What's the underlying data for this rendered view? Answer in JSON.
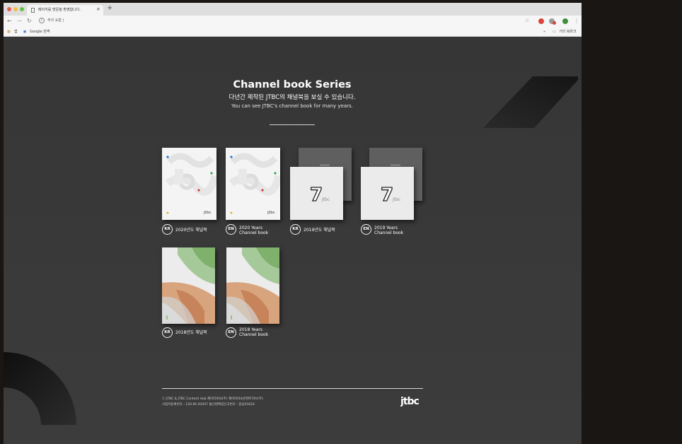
{
  "browser": {
    "tab_title": "페이지를 방문을 환영합니다.",
    "tab_close": "×",
    "new_tab": "+",
    "url_text": "주의 요함 |",
    "bookmarks": [
      "앱",
      "Google 번역"
    ],
    "bookmarks_other": "기타 북마크",
    "bookmarks_more": "»"
  },
  "page": {
    "title": "Channel book Series",
    "subtitle_ko": "다년간 제작된 JTBC의 채널북을 보실 수 있습니다.",
    "subtitle_en": "You can see JTBC's channel book for many years."
  },
  "books": [
    {
      "lang": "KR",
      "label": "2020년도 채널북",
      "style": "2020"
    },
    {
      "lang": "EN",
      "label": "2020 Years\nChannel book",
      "style": "2020"
    },
    {
      "lang": "KR",
      "label": "2019년도 채널북",
      "style": "2019"
    },
    {
      "lang": "EN",
      "label": "2019 Years\nChannel book",
      "style": "2019"
    },
    {
      "lang": "KR",
      "label": "2018년도 채널북",
      "style": "2018"
    },
    {
      "lang": "EN",
      "label": "2018 Years\nChannel book",
      "style": "2018"
    }
  ],
  "footer": {
    "copyright": "ⓒ JTBC & JTBC Content Hub 제이티비씨(주) 제이티비씨콘텐트허브(주)",
    "biz_no": "사업자등록번호 : 120-81-93457 통신판매업신고번호 : 중남01616",
    "logo": "jtbc"
  },
  "colors": {
    "background": "#3a3a3a",
    "text": "#ffffff",
    "outer": "#1a1614"
  }
}
